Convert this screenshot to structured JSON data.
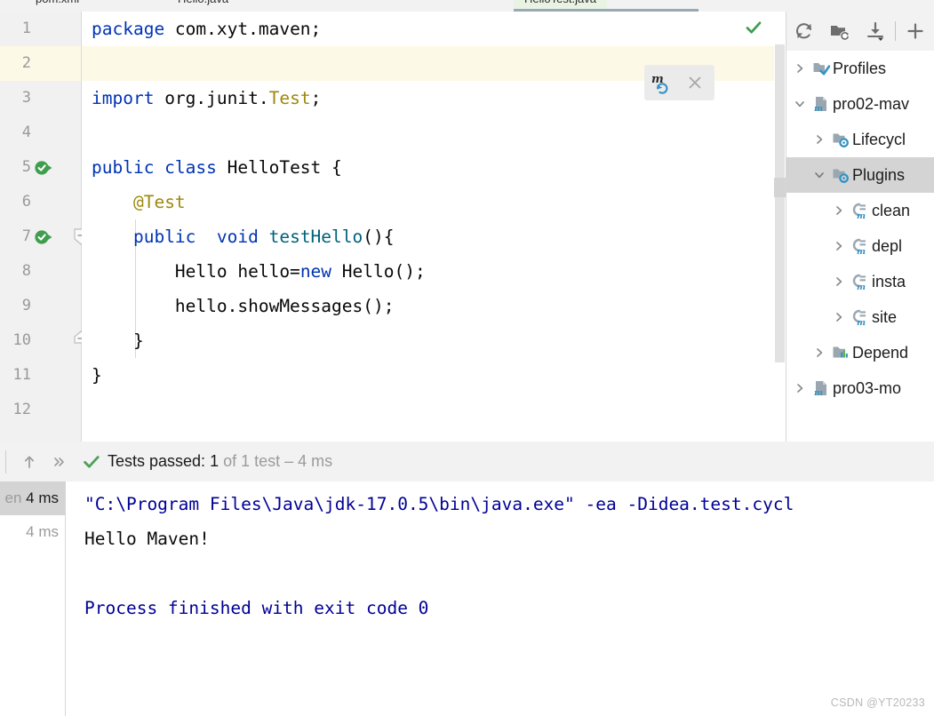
{
  "window": {
    "watermark": "CSDN @YT20233"
  },
  "tabs": [
    {
      "label": "pom.xml",
      "active": false
    },
    {
      "label": "Hello.java",
      "active": false
    },
    {
      "label": "HelloTest.java",
      "active": true
    }
  ],
  "editor": {
    "lines": [
      {
        "number": "1",
        "caret": false,
        "run_icon": false,
        "fold": "",
        "tokens": [
          {
            "t": "package",
            "c": "kw"
          },
          {
            "t": " com.xyt.maven;",
            "c": "cls"
          }
        ]
      },
      {
        "number": "2",
        "caret": true,
        "run_icon": false,
        "fold": "",
        "tokens": [
          {
            "t": "",
            "c": "cls"
          }
        ]
      },
      {
        "number": "3",
        "caret": false,
        "run_icon": false,
        "fold": "",
        "tokens": [
          {
            "t": "import",
            "c": "kw"
          },
          {
            "t": " org.junit.",
            "c": "cls"
          },
          {
            "t": "Test",
            "c": "anno"
          },
          {
            "t": ";",
            "c": "cls"
          }
        ]
      },
      {
        "number": "4",
        "caret": false,
        "run_icon": false,
        "fold": "",
        "tokens": [
          {
            "t": "",
            "c": "cls"
          }
        ]
      },
      {
        "number": "5",
        "caret": false,
        "run_icon": true,
        "fold": "",
        "tokens": [
          {
            "t": "public class ",
            "c": "kw"
          },
          {
            "t": "HelloTest {",
            "c": "cls"
          }
        ]
      },
      {
        "number": "6",
        "caret": false,
        "run_icon": false,
        "fold": "",
        "tokens": [
          {
            "t": "    ",
            "c": "cls"
          },
          {
            "t": "@Test",
            "c": "anno"
          }
        ]
      },
      {
        "number": "7",
        "caret": false,
        "run_icon": true,
        "fold": "collapse",
        "tokens": [
          {
            "t": "    ",
            "c": "cls"
          },
          {
            "t": "public  void ",
            "c": "kw"
          },
          {
            "t": "testHello",
            "c": "meth"
          },
          {
            "t": "(){",
            "c": "cls"
          }
        ]
      },
      {
        "number": "8",
        "caret": false,
        "run_icon": false,
        "fold": "",
        "tokens": [
          {
            "t": "        Hello hello=",
            "c": "cls"
          },
          {
            "t": "new",
            "c": "kw"
          },
          {
            "t": " Hello();",
            "c": "cls"
          }
        ]
      },
      {
        "number": "9",
        "caret": false,
        "run_icon": false,
        "fold": "",
        "tokens": [
          {
            "t": "        hello.showMessages();",
            "c": "cls"
          }
        ]
      },
      {
        "number": "10",
        "caret": false,
        "run_icon": false,
        "fold": "end",
        "tokens": [
          {
            "t": "    }",
            "c": "cls"
          }
        ]
      },
      {
        "number": "11",
        "caret": false,
        "run_icon": false,
        "fold": "",
        "tokens": [
          {
            "t": "}",
            "c": "cls"
          }
        ]
      },
      {
        "number": "12",
        "caret": false,
        "run_icon": false,
        "fold": "",
        "tokens": [
          {
            "t": "",
            "c": "cls"
          }
        ]
      }
    ]
  },
  "maven_popup": {
    "reload_title": "Load Maven Changes",
    "close_title": "Close"
  },
  "maven_panel": {
    "toolbar": [
      {
        "name": "reload-all-maven-projects-icon",
        "title": "Reload All Maven Projects"
      },
      {
        "name": "generate-sources-icon",
        "title": "Generate Sources and Update Folders"
      },
      {
        "name": "download-sources-icon",
        "title": "Download Sources and/or Documentation"
      },
      {
        "name": "add-maven-project-icon",
        "title": "Add Maven Project"
      }
    ],
    "tree": [
      {
        "label": "Profiles",
        "icon": "profiles-icon",
        "indent": 0,
        "chevron": "right",
        "selected": false
      },
      {
        "label": "pro02-mav",
        "icon": "maven-project-icon",
        "indent": 0,
        "chevron": "down",
        "selected": false
      },
      {
        "label": "Lifecycl",
        "icon": "lifecycle-icon",
        "indent": 1,
        "chevron": "right",
        "selected": false
      },
      {
        "label": "Plugins",
        "icon": "plugins-icon",
        "indent": 1,
        "chevron": "down",
        "selected": true
      },
      {
        "label": "clean",
        "icon": "plugin-icon",
        "indent": 2,
        "chevron": "right",
        "selected": false
      },
      {
        "label": "depl",
        "icon": "plugin-icon",
        "indent": 2,
        "chevron": "right",
        "selected": false
      },
      {
        "label": "insta",
        "icon": "plugin-icon",
        "indent": 2,
        "chevron": "right",
        "selected": false
      },
      {
        "label": "site",
        "icon": "plugin-icon",
        "indent": 2,
        "chevron": "right",
        "selected": false
      },
      {
        "label": "Depend",
        "icon": "dependencies-icon",
        "indent": 1,
        "chevron": "right",
        "selected": false
      },
      {
        "label": "pro03-mo",
        "icon": "maven-project-icon",
        "indent": 0,
        "chevron": "right",
        "selected": false
      }
    ]
  },
  "test_panel": {
    "toolbar": {
      "up_title": "Previous Occurrence",
      "expand_title": "Expand All"
    },
    "status_prefix": "Tests passed: ",
    "status_count": "1",
    "status_suffix": " of 1 test – 4 ms",
    "tree_rows": [
      {
        "label_dim": "en",
        "label": "4 ms",
        "selected": true
      },
      {
        "label_dim": "",
        "label": "4 ms",
        "selected": false
      }
    ]
  },
  "console": {
    "lines": [
      {
        "text": "\"C:\\Program Files\\Java\\jdk-17.0.5\\bin\\java.exe\" -ea -Didea.test.cycl",
        "color": "c-blue"
      },
      {
        "text": "Hello Maven!",
        "color": "c-black"
      },
      {
        "text": "",
        "color": "c-black"
      },
      {
        "text": "Process finished with exit code 0",
        "color": "c-blue"
      }
    ]
  },
  "colors": {
    "keyword": "#0033b3",
    "annotation": "#9e880d",
    "method": "#00627a",
    "console_blue": "#000096",
    "caret_line": "#fdf9e7",
    "pass_green": "#499c54",
    "selection_gray": "#d4d4d4"
  }
}
